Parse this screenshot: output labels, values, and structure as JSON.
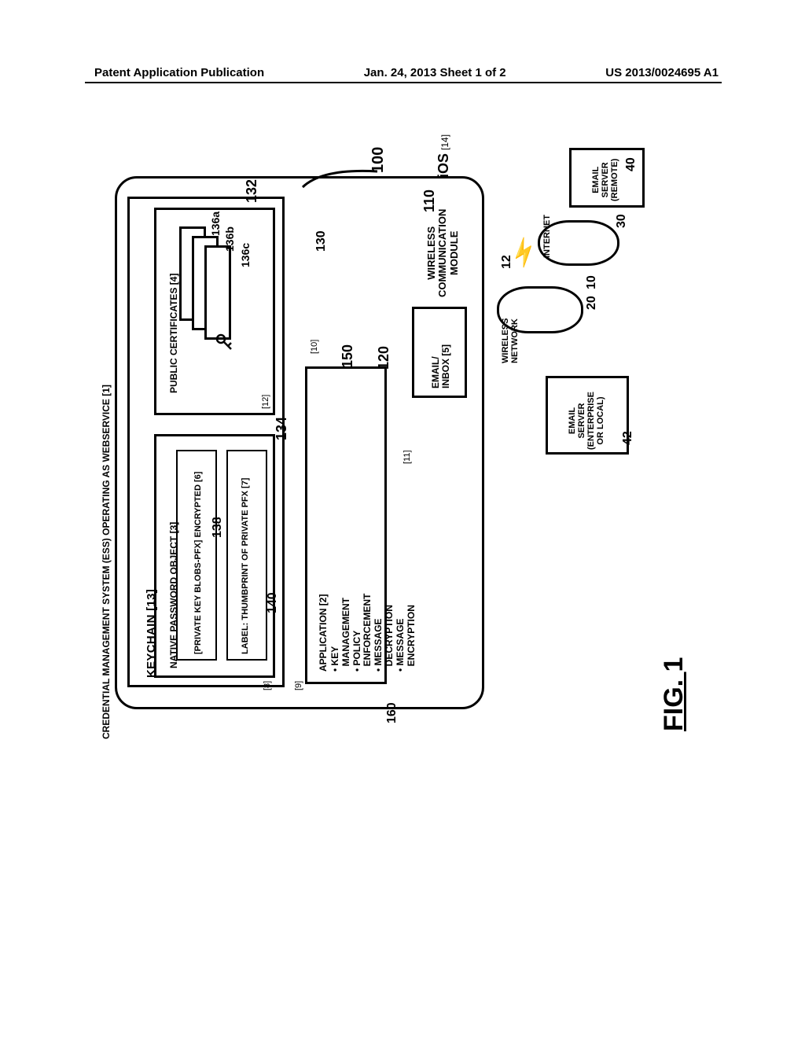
{
  "header": {
    "left": "Patent Application Publication",
    "mid": "Jan. 24, 2013  Sheet 1 of 2",
    "right": "US 2013/0024695 A1"
  },
  "figure_label": {
    "prefix": "FIG. ",
    "number": "1"
  },
  "device": {
    "os_label": "iOS",
    "os_bracket": "[14]",
    "ref": "100"
  },
  "keychain": {
    "title": "KEYCHAIN [13]",
    "public_cert_title": "PUBLIC CERTIFICATES [4]",
    "ref_box": "132",
    "cert_refs": {
      "a": "136a",
      "b": "136b",
      "c": "136c"
    },
    "npo_title": "NATIVE PASSWORD OBJECT [3]",
    "npo_ref": "134",
    "pkb_title": "[PRIVATE KEY BLOBS-PFX]\nENCRYPTED [6]",
    "pkb_ref": "138",
    "thumb_title": "LABEL: THUMBPRINT OF\nPRIVATE PFX [7]",
    "thumb_ref": "140"
  },
  "application": {
    "title": "APPLICATION [2]",
    "bullets": "• KEY\n  MANAGEMENT\n• POLICY\n  ENFORCEMENT\n• MESSAGE\n  DECRYPTION\n• MESSAGE\n  ENCRYPTION",
    "ref": "150"
  },
  "mail": {
    "title": "EMAIL/\nINBOX [5]",
    "ref": "120"
  },
  "wcm": {
    "title": "WIRELESS\nCOMMUNICATION\nMODULE",
    "ref": "110"
  },
  "network": {
    "remote": "EMAIL\nSERVER\n(REMOTE)",
    "remote_ref": "40",
    "local": "EMAIL\nSERVER\n(ENTERPRISE\nOR LOCAL)",
    "local_ref": "42",
    "internet": "INTERNET",
    "internet_ref": "30",
    "wireless": "WIRELESS\nNETWORK",
    "wireless_refs": {
      "a": "10",
      "b": "20"
    },
    "bolt_ref": "12",
    "device_ref_130": "130",
    "ess_ref": "160"
  },
  "markers": {
    "m10": "[10]",
    "m12": "[12]",
    "m11": "[11]",
    "m9": "[9]",
    "m8": "[8]"
  },
  "ess": {
    "label": "CREDENTIAL MANAGEMENT SYSTEM (ESS) OPERATING AS WEBSERVICE [1]"
  }
}
